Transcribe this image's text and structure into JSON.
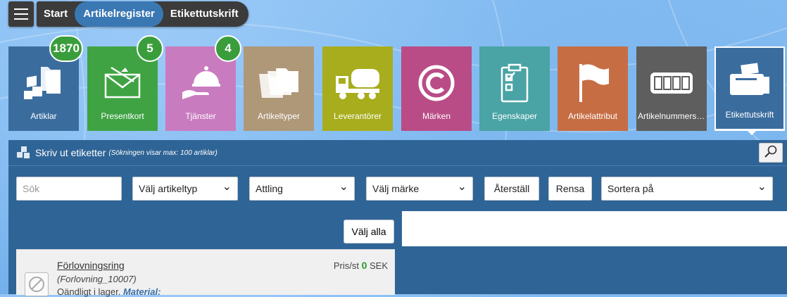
{
  "nav": {
    "crumbs": [
      "Start",
      "Artikelregister",
      "Etikettutskrift"
    ]
  },
  "tiles": [
    {
      "label": "Artiklar",
      "badge": "1870",
      "color": "#3a6d9e",
      "icon": "articles-icon"
    },
    {
      "label": "Presentkort",
      "badge": "5",
      "color": "#3fa343",
      "icon": "gift-card-icon"
    },
    {
      "label": "Tjänster",
      "badge": "4",
      "color": "#c97bbf",
      "icon": "service-cloche-icon"
    },
    {
      "label": "Artikeltyper",
      "color": "#ae9878",
      "icon": "folders-icon"
    },
    {
      "label": "Leverantörer",
      "color": "#a7ad1c",
      "icon": "truck-icon"
    },
    {
      "label": "Märken",
      "color": "#b94c86",
      "icon": "copyright-icon"
    },
    {
      "label": "Egenskaper",
      "color": "#4aa3a4",
      "icon": "clipboard-check-icon"
    },
    {
      "label": "Artikelattribut",
      "color": "#c66d44",
      "icon": "flag-icon"
    },
    {
      "label": "Artikelnummerse...",
      "color": "#5e5e5e",
      "icon": "counter-icon"
    },
    {
      "label": "Etikettutskrift",
      "color": "#3a6d9e",
      "icon": "printer-icon"
    }
  ],
  "panel": {
    "title": "Skriv ut etiketter",
    "subtitle": "(Sökningen visar max: 100 artiklar)"
  },
  "filters": {
    "search_placeholder": "Sök",
    "article_type": "Välj artikeltyp",
    "supplier": "Attling",
    "brand": "Välj märke",
    "reset": "Återställ",
    "clear": "Rensa",
    "sort": "Sortera på"
  },
  "select_all": "Välj alla",
  "product": {
    "name": "Förlovningsring",
    "id": "(Forlovning_10007)",
    "stock": "Oändligt i lager.",
    "material_label": "Material:",
    "price_label": "Pris/st",
    "price_value": "0",
    "currency": "SEK"
  }
}
